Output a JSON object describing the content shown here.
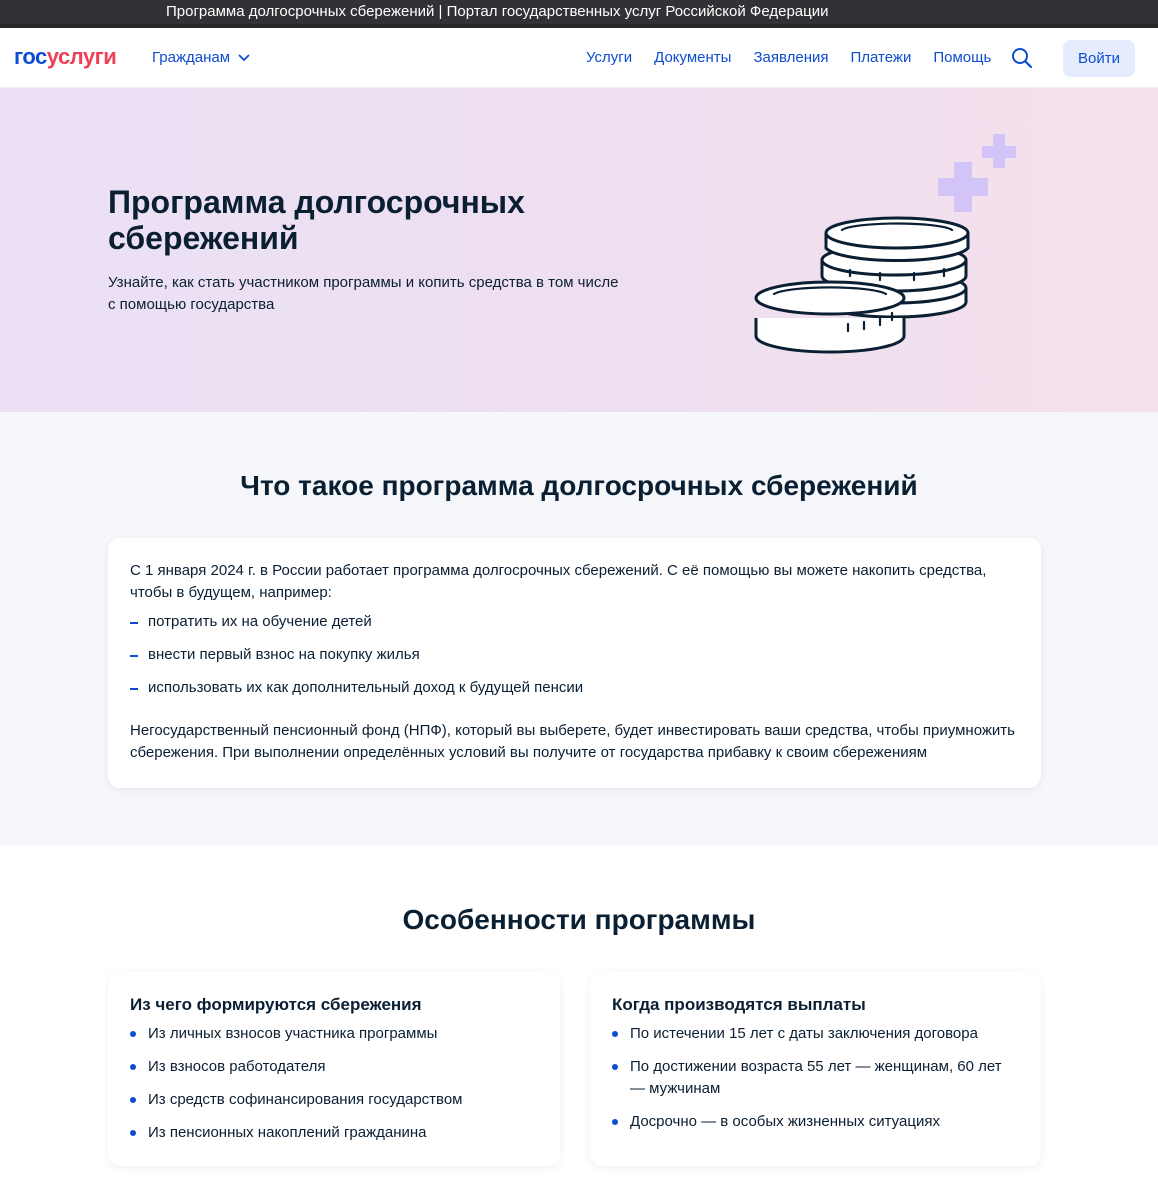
{
  "window": {
    "title": "Программа долгосрочных сбережений | Портал государственных услуг Российской Федерации"
  },
  "header": {
    "logo_part1": "гос",
    "logo_part2": "услуги",
    "citizens_label": "Гражданам",
    "nav": [
      "Услуги",
      "Документы",
      "Заявления",
      "Платежи",
      "Помощь"
    ],
    "login_label": "Войти",
    "icons": {
      "search": "search-icon",
      "chevron": "chevron-down-icon"
    }
  },
  "hero": {
    "title": "Программа долгосрочных сбережений",
    "subtitle": "Узнайте, как стать участником программы и копить средства в том числе с помощью государства"
  },
  "about": {
    "title": "Что такое программа долгосрочных сбережений",
    "intro": "С 1 января 2024 г. в России работает программа долгосрочных сбережений. С её помощью вы можете накопить средства, чтобы в будущем, например:",
    "items": [
      "потратить их на обучение детей",
      "внести первый взнос на покупку жилья",
      "использовать их как дополнительный доход к будущей пенсии"
    ],
    "outro": "Негосударственный пенсионный фонд (НПФ), который вы выберете, будет инвестировать ваши средства, чтобы приумножить сбережения. При выполнении определённых условий вы получите от государства прибавку к своим сбережениям"
  },
  "features": {
    "title": "Особенности программы",
    "savings": {
      "title": "Из чего формируются сбережения",
      "items": [
        "Из личных взносов участника программы",
        "Из взносов работодателя",
        "Из средств софинансирования государством",
        "Из пенсионных накоплений гражданина"
      ]
    },
    "payouts": {
      "title": "Когда производятся выплаты",
      "items": [
        "По истечении 15 лет с даты заключения договора",
        "По достижении возраста 55 лет — женщинам, 60 лет — мужчинам",
        "Досрочно — в особых жизненных ситуациях"
      ]
    }
  },
  "colors": {
    "brand_blue": "#0d4cd3",
    "brand_red": "#ee3f58",
    "text": "#0b1f33",
    "accent_lilac": "#d3c4f7"
  }
}
